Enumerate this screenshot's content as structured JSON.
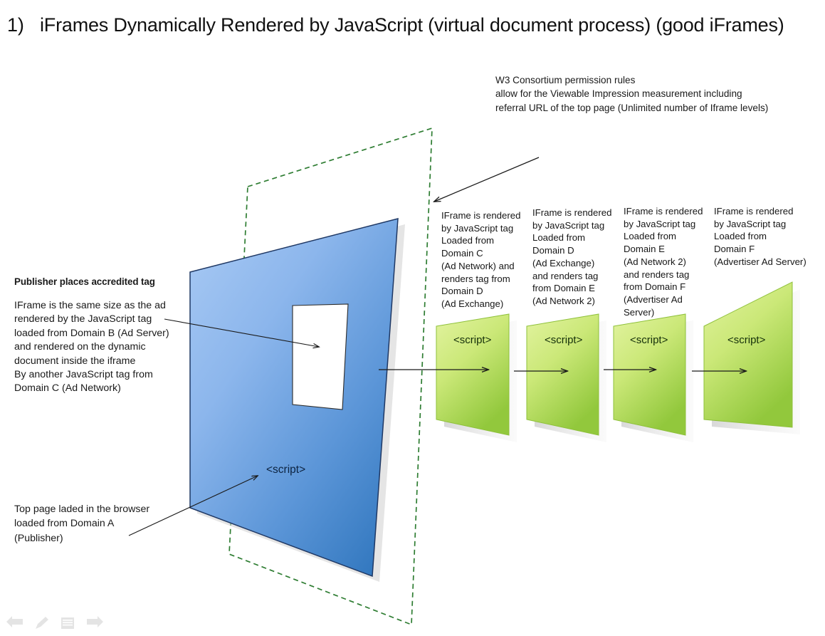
{
  "title": {
    "number": "1)",
    "text": "iFrames Dynamically Rendered by JavaScript (virtual document process) (good iFrames)"
  },
  "notes": {
    "w3": "W3 Consortium permission rules\nallow for  the Viewable Impression measurement including\nreferral URL of the top page (Unlimited number of Iframe levels)",
    "publisher_heading": "Publisher places accredited tag",
    "iframe_description": "IFrame  is the same size as the ad\nrendered by the JavaScript tag\nloaded from Domain B (Ad Server)\nand rendered on the dynamic\ndocument inside the iframe\nBy another JavaScript tag from\nDomain C (Ad Network)",
    "top_page": "Top page laded in the browser\nloaded from Domain A\n(Publisher)"
  },
  "panels": [
    {
      "id": "domain-c",
      "note": "IFrame is rendered\nby JavaScript tag\nLoaded from\nDomain C\n(Ad Network) and\nrenders tag from\nDomain D\n(Ad Exchange)",
      "script_label": "<script>"
    },
    {
      "id": "domain-d",
      "note": "IFrame is rendered\nby JavaScript tag\nLoaded from\nDomain D\n(Ad Exchange)\nand renders tag\nfrom Domain E\n(Ad Network 2)",
      "script_label": "<script>"
    },
    {
      "id": "domain-e",
      "note": "IFrame is rendered\nby JavaScript tag\nLoaded from\nDomain E\n(Ad Network 2)\nand renders tag\nfrom Domain  F\n(Advertiser Ad Server)",
      "script_label": "<script>"
    },
    {
      "id": "domain-f",
      "note": "IFrame is rendered\nby JavaScript tag\nLoaded from\nDomain F\n(Advertiser Ad Server)",
      "script_label": "<script>"
    }
  ],
  "top_page_panel": {
    "script_label": "<script>"
  },
  "colors": {
    "blue_light": "#9ec3f2",
    "blue_dark": "#3a7fc6",
    "blue_stroke": "#1f3864",
    "green_light": "#dcf08e",
    "green_dark": "#92c83c",
    "green_stroke": "#8ec03a",
    "dashed_green": "#2e7d32",
    "arrow": "#1a1a1a",
    "text": "#1a1a1a"
  },
  "toolbar": {
    "icons": [
      "back-arrow-icon",
      "pencil-icon",
      "document-icon",
      "forward-arrow-icon"
    ]
  }
}
